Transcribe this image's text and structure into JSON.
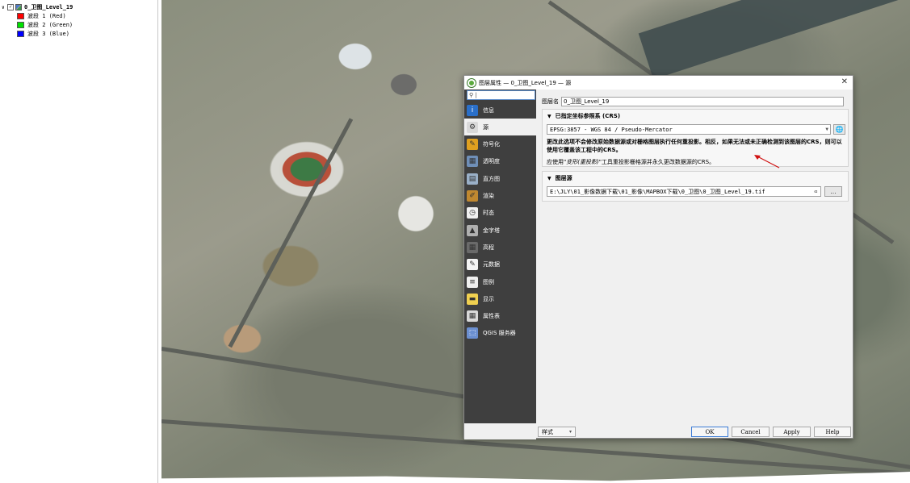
{
  "layers": {
    "root": {
      "expander": "∨",
      "check": "✓",
      "name": "0_卫图_Level_19"
    },
    "bands": [
      {
        "label": "波段 1 (Red)",
        "color": "#ff0000"
      },
      {
        "label": "波段 2 (Green)",
        "color": "#00e000"
      },
      {
        "label": "波段 3 (Blue)",
        "color": "#0000ff"
      }
    ]
  },
  "dialog": {
    "title": "图层属性 — 0_卫图_Level_19 — 源",
    "close": "✕",
    "search": {
      "value": "",
      "icon": "⚲"
    },
    "sidebar": [
      {
        "key": "info",
        "label": "信息",
        "icon": "i",
        "icon_bg": "#2a6fc9"
      },
      {
        "key": "source",
        "label": "源",
        "icon": "⚙",
        "icon_bg": "#d9d9d9"
      },
      {
        "key": "symbology",
        "label": "符号化",
        "icon": "✎",
        "icon_bg": "#e0a020"
      },
      {
        "key": "transparency",
        "label": "透明度",
        "icon": "▦",
        "icon_bg": "#6f8fb8"
      },
      {
        "key": "histogram",
        "label": "直方图",
        "icon": "▤",
        "icon_bg": "#9ab0c8"
      },
      {
        "key": "rendering",
        "label": "渲染",
        "icon": "✐",
        "icon_bg": "#c08830"
      },
      {
        "key": "temporal",
        "label": "时态",
        "icon": "◷",
        "icon_bg": "#f0f0f0"
      },
      {
        "key": "pyramids",
        "label": "金字塔",
        "icon": "▲",
        "icon_bg": "#b0b0b0"
      },
      {
        "key": "elevation",
        "label": "高程",
        "icon": "▦",
        "icon_bg": "#6a6a6a"
      },
      {
        "key": "metadata",
        "label": "元数据",
        "icon": "✎",
        "icon_bg": "#f4f4f4"
      },
      {
        "key": "legend",
        "label": "图例",
        "icon": "≡",
        "icon_bg": "#f0f0f0"
      },
      {
        "key": "display",
        "label": "显示",
        "icon": "▬",
        "icon_bg": "#f0d050"
      },
      {
        "key": "attribute-table",
        "label": "属性表",
        "icon": "▦",
        "icon_bg": "#d8d8d8"
      },
      {
        "key": "qgis-server",
        "label": "QGIS 服务器",
        "icon": "⬚",
        "icon_bg": "#6b8fd0"
      }
    ],
    "active_item": "source",
    "layer_name_label": "图层名",
    "layer_name_value": "0_卫图_Level_19",
    "crs_group": {
      "title": "已指定坐标参照系 (CRS)",
      "value": "EPSG:3857 - WGS 84 / Pseudo-Mercator",
      "warning": "更改此选项不会修改原始数据源或对栅格图层执行任何重投影。相反，如果无法或未正确检测到该图层的CRS，则可以使用它覆盖该工程中的CRS。",
      "note_prefix": "应使用\"",
      "note_tool": "变形(重投影)",
      "note_suffix": "\"工具重投影栅格源并永久更改数据源的CRS。"
    },
    "source_group": {
      "title": "图层源",
      "path": "E:\\JLY\\01_影像数据下载\\01_影像\\MAPBOX下载\\0_卫图\\0_卫图_Level_19.tif",
      "browse": "…"
    },
    "buttons": {
      "style": "样式",
      "ok": "OK",
      "cancel": "Cancel",
      "apply": "Apply",
      "help": "Help"
    }
  }
}
